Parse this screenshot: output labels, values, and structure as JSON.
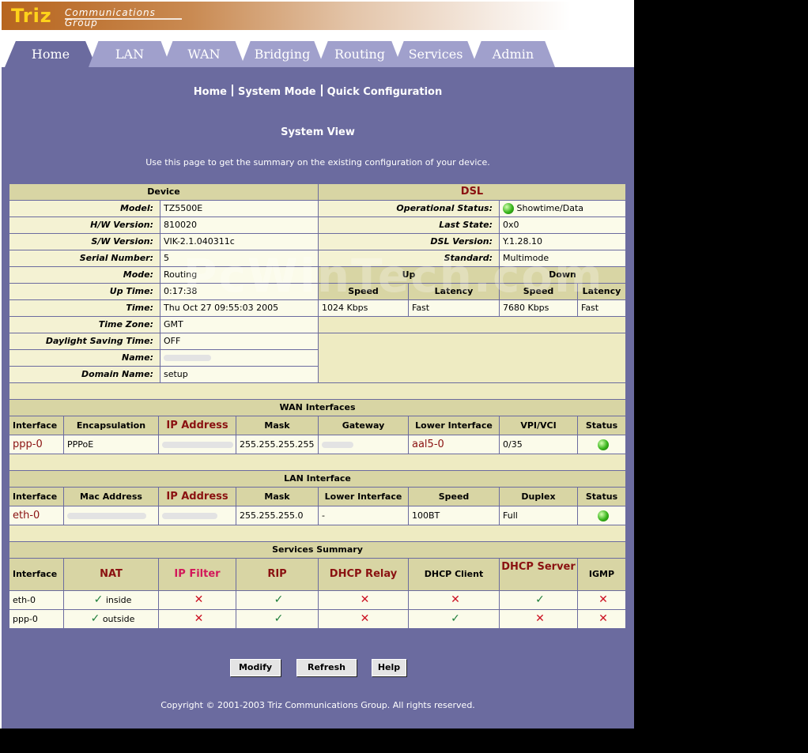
{
  "brand": {
    "logo_text": "Triz",
    "tagline_1": "Communications",
    "tagline_2": "Group"
  },
  "tabs": [
    "Home",
    "LAN",
    "WAN",
    "Bridging",
    "Routing",
    "Services",
    "Admin"
  ],
  "subnav": [
    "Home",
    "System Mode",
    "Quick Configuration"
  ],
  "page": {
    "title": "System View",
    "description": "Use this page to get the summary on the existing configuration of your device."
  },
  "device": {
    "header": "Device",
    "rows": [
      {
        "label": "Model:",
        "value": "TZ5500E"
      },
      {
        "label": "H/W Version:",
        "value": "810020"
      },
      {
        "label": "S/W Version:",
        "value": "VIK-2.1.040311c"
      },
      {
        "label": "Serial Number:",
        "value": "5"
      },
      {
        "label": "Mode:",
        "value": "Routing"
      },
      {
        "label": "Up Time:",
        "value": "0:17:38"
      },
      {
        "label": "Time:",
        "value": "Thu Oct 27 09:55:03 2005"
      },
      {
        "label": "Time Zone:",
        "value": "GMT"
      },
      {
        "label": "Daylight Saving Time:",
        "value": "OFF"
      },
      {
        "label": "Name:",
        "value": ""
      },
      {
        "label": "Domain Name:",
        "value": "setup"
      }
    ]
  },
  "dsl": {
    "header": "DSL",
    "rows": [
      {
        "label": "Operational Status:",
        "value": "Showtime/Data"
      },
      {
        "label": "Last State:",
        "value": "0x0"
      },
      {
        "label": "DSL Version:",
        "value": "Y.1.28.10"
      },
      {
        "label": "Standard:",
        "value": "Multimode"
      }
    ],
    "up_label": "Up",
    "down_label": "Down",
    "col_speed": "Speed",
    "col_latency": "Latency",
    "up_speed": "1024 Kbps",
    "up_latency": "Fast",
    "down_speed": "7680 Kbps",
    "down_latency": "Fast"
  },
  "wan": {
    "title": "WAN Interfaces",
    "columns": [
      "Interface",
      "Encapsulation",
      "IP Address",
      "Mask",
      "Gateway",
      "Lower Interface",
      "VPI/VCI",
      "Status"
    ],
    "row": {
      "interface": "ppp-0",
      "encapsulation": "PPPoE",
      "mask": "255.255.255.255",
      "lower": "aal5-0",
      "vpivci": "0/35"
    }
  },
  "lan": {
    "title": "LAN Interface",
    "columns": [
      "Interface",
      "Mac Address",
      "IP Address",
      "Mask",
      "Lower Interface",
      "Speed",
      "Duplex",
      "Status"
    ],
    "row": {
      "interface": "eth-0",
      "mask": "255.255.255.0",
      "lower": "-",
      "speed": "100BT",
      "duplex": "Full"
    }
  },
  "services": {
    "title": "Services Summary",
    "columns": [
      "Interface",
      "NAT",
      "IP Filter",
      "RIP",
      "DHCP Relay",
      "DHCP Client",
      "DHCP Server",
      "IGMP"
    ],
    "rows": [
      {
        "interface": "eth-0",
        "nat": "inside"
      },
      {
        "interface": "ppp-0",
        "nat": "outside"
      }
    ]
  },
  "buttons": {
    "modify": "Modify",
    "refresh": "Refresh",
    "help": "Help"
  },
  "watermark": "PcWinTech.com",
  "copyright": "Copyright © 2001-2003 Triz Communications Group. All rights reserved."
}
